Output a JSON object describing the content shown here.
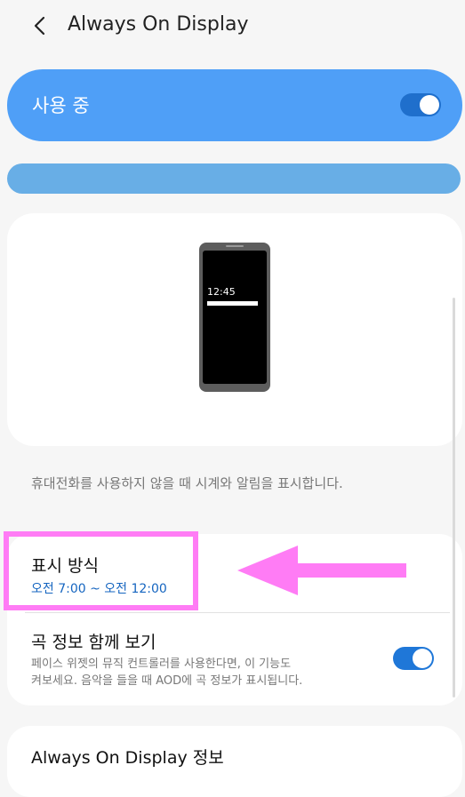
{
  "header": {
    "title": "Always On Display",
    "back_icon": "chevron-left-icon"
  },
  "master": {
    "label": "사용 중",
    "enabled": true
  },
  "preview": {
    "clock": "12:45"
  },
  "description": "휴대전화를 사용하지 않을 때 시계와 알림을 표시합니다.",
  "settings": {
    "display_mode": {
      "label": "표시 방식",
      "value": "오전 7:00 ~ 오전 12:00"
    },
    "music_info": {
      "label": "곡 정보 함께 보기",
      "description_line1": "페이스 위젯의 뮤직 컨트롤러를 사용한다면, 이 기능도",
      "description_line2": "켜보세요. 음악을 들을 때 AOD에 곡 정보가 표시됩니다.",
      "enabled": true
    }
  },
  "about": {
    "label": "Always On Display 정보"
  },
  "colors": {
    "accent": "#4f9ff7",
    "toggle_on": "#1f77d8",
    "link": "#1565c0",
    "highlight": "#ff7cf5"
  }
}
